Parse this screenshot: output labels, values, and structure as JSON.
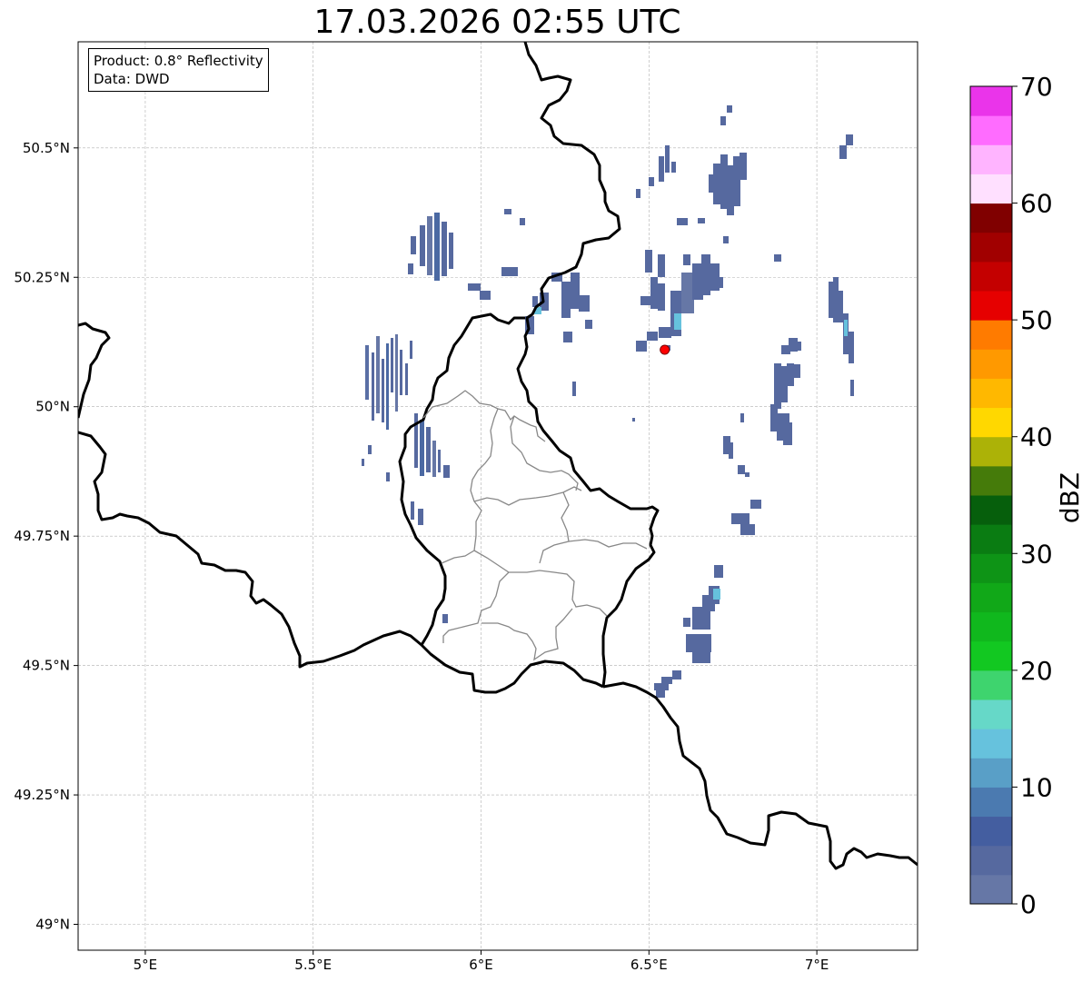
{
  "title": "17.03.2026 02:55 UTC",
  "info": {
    "product": "Product: 0.8° Reflectivity",
    "source": "Data: DWD"
  },
  "map": {
    "lon_range": [
      4.8,
      7.3
    ],
    "lat_range": [
      48.95,
      50.705
    ],
    "x_ticks": [
      {
        "value": 5.0,
        "label": "5°E"
      },
      {
        "value": 5.5,
        "label": "5.5°E"
      },
      {
        "value": 6.0,
        "label": "6°E"
      },
      {
        "value": 6.5,
        "label": "6.5°E"
      },
      {
        "value": 7.0,
        "label": "7°E"
      }
    ],
    "y_ticks": [
      {
        "value": 50.5,
        "label": "50.5°N"
      },
      {
        "value": 50.25,
        "label": "50.25°N"
      },
      {
        "value": 50.0,
        "label": "50°N"
      },
      {
        "value": 49.75,
        "label": "49.75°N"
      },
      {
        "value": 49.5,
        "label": "49.5°N"
      },
      {
        "value": 49.25,
        "label": "49.25°N"
      },
      {
        "value": 49.0,
        "label": "49°N"
      }
    ],
    "grid": true,
    "radar_site": {
      "lon": 6.547,
      "lat": 50.11,
      "color": "#ff0000"
    }
  },
  "colorbar": {
    "label": "dBZ",
    "min": 0,
    "max": 70,
    "step": 2.5,
    "tick_labels": [
      "0",
      "10",
      "20",
      "30",
      "40",
      "50",
      "60",
      "70"
    ],
    "colors": [
      "#6677a6",
      "#56699f",
      "#445ea0",
      "#4b7ab0",
      "#599fc7",
      "#66c2dd",
      "#66d8c8",
      "#3ed46e",
      "#12c821",
      "#10b81d",
      "#11a818",
      "#0e9416",
      "#0a7c12",
      "#065f0c",
      "#457b0a",
      "#acb207",
      "#ffd800",
      "#ffb800",
      "#ff9900",
      "#ff7b00",
      "#e60000",
      "#c40000",
      "#a10000",
      "#800000",
      "#ffe0ff",
      "#ffb4ff",
      "#ff6cff",
      "#ea34ea"
    ]
  }
}
